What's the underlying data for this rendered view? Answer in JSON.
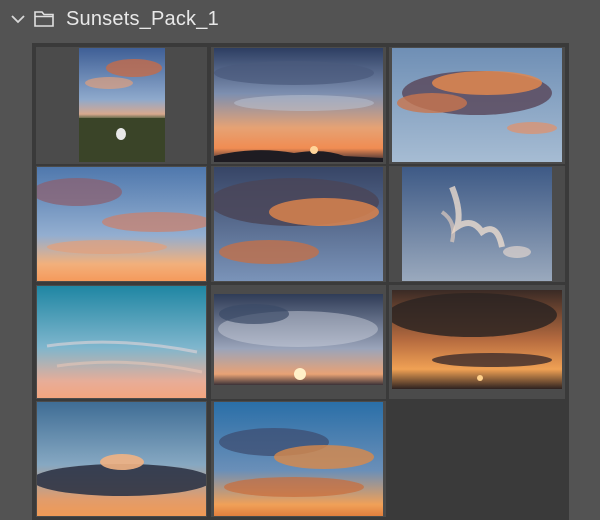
{
  "folder": {
    "name": "Sunsets_Pack_1",
    "expanded": true,
    "icon": "folder-icon",
    "toggle_icon": "chevron-down-icon"
  },
  "colors": {
    "panel_bg": "#535353",
    "grid_bg": "#3a3a3a",
    "cell_bg": "#4b4b4b",
    "text": "#e8e8e8"
  },
  "thumbnails": [
    {
      "id": 1,
      "icon": "portrait-sunset-thumbnail"
    },
    {
      "id": 2,
      "icon": "sunset-horizon-thumbnail"
    },
    {
      "id": 3,
      "icon": "orange-clouds-thumbnail"
    },
    {
      "id": 4,
      "icon": "pink-clouds-thumbnail"
    },
    {
      "id": 5,
      "icon": "dramatic-clouds-thumbnail"
    },
    {
      "id": 6,
      "icon": "wispy-cloud-thumbnail"
    },
    {
      "id": 7,
      "icon": "teal-sky-thumbnail"
    },
    {
      "id": 8,
      "icon": "sun-rays-thumbnail"
    },
    {
      "id": 9,
      "icon": "dark-sunset-thumbnail"
    },
    {
      "id": 10,
      "icon": "storm-cloud-thumbnail"
    },
    {
      "id": 11,
      "icon": "blue-orange-clouds-thumbnail"
    }
  ]
}
